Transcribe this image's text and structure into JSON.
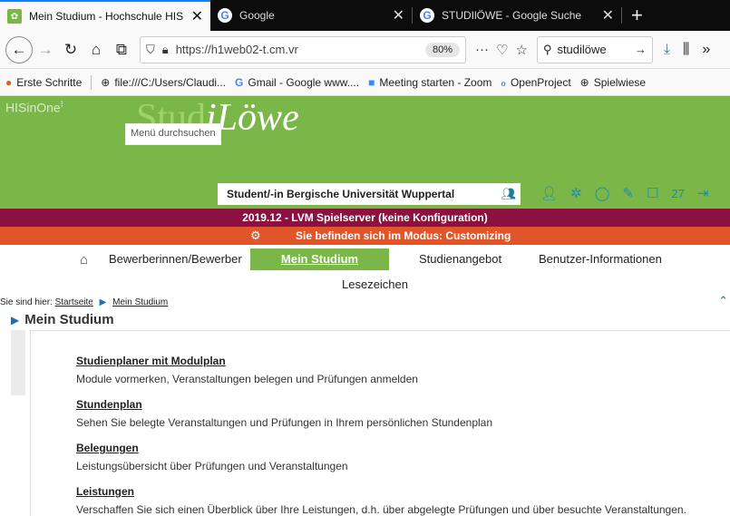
{
  "tabs": [
    {
      "title": "Mein Studium - Hochschule HIS",
      "favicon": "hisinone-favicon",
      "close": "✕"
    },
    {
      "title": "Google",
      "favicon": "google-favicon",
      "close": "✕"
    },
    {
      "title": "STUDIlÖWE - Google Suche",
      "favicon": "google-favicon",
      "close": "✕"
    }
  ],
  "navbar": {
    "url": "https://h1web02-t.cm.vr",
    "zoom": "80%",
    "search_value": "studilöwe"
  },
  "bookmarks": [
    {
      "label": "Erste Schritte",
      "icon": "firefox-icon"
    },
    {
      "label": "file:///C:/Users/Claudi...",
      "icon": "globe-icon"
    },
    {
      "label": "Gmail - Google www....",
      "icon": "google-icon"
    },
    {
      "label": "Meeting starten - Zoom",
      "icon": "zoom-icon"
    },
    {
      "label": "OpenProject",
      "icon": "openproject-icon"
    },
    {
      "label": "Spielwiese",
      "icon": "globe-icon"
    }
  ],
  "header": {
    "brand": "HISinOne",
    "logo_stud": "Stud",
    "logo_loewe": "iLöwe",
    "menu_search": "Menü durchsuchen",
    "role": "Student/-in Bergische Universität Wuppertal",
    "message_count": "27"
  },
  "banners": {
    "server": "2019.12 - LVM Spielserver (keine Konfiguration)",
    "mode": "Sie befinden sich im Modus: Customizing"
  },
  "mainnav": {
    "items": [
      "Bewerberinnen/Bewerber",
      "Mein Studium",
      "Studienangebot",
      "Benutzer-Informationen"
    ],
    "secondary": "Lesezeichen"
  },
  "breadcrumb": {
    "prefix": "Sie sind hier:",
    "items": [
      "Startseite",
      "Mein Studium"
    ]
  },
  "page_title": "Mein Studium",
  "entries": [
    {
      "title": "Studienplaner mit Modulplan",
      "desc": "Module vormerken, Veranstaltungen belegen und Prüfungen anmelden"
    },
    {
      "title": "Stundenplan",
      "desc": "Sehen Sie belegte Veranstaltungen und Prüfungen in Ihrem persönlichen Stundenplan"
    },
    {
      "title": "Belegungen",
      "desc": "Leistungsübersicht über Prüfungen und Veranstaltungen"
    },
    {
      "title": "Leistungen",
      "desc": "Verschaffen Sie sich einen Überblick über Ihre Leistungen, d.h. über abgelegte Prüfungen und über besuchte Veranstaltungen."
    }
  ],
  "colors": {
    "header_green": "#7ab648",
    "server_bar": "#8c1040",
    "mode_bar": "#e0562a",
    "icon_blue": "#1a8cbf"
  }
}
